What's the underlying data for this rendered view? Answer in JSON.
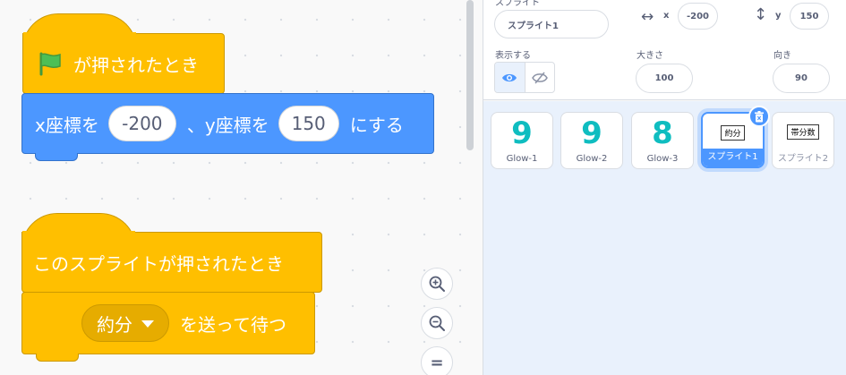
{
  "workspace": {
    "script1": {
      "hat_label": "が押されたとき",
      "flag_icon": "green-flag-icon",
      "goto_x_label": "x座標を",
      "x_value": "-200",
      "goto_y_label": "、y座標を",
      "y_value": "150",
      "goto_suffix": "にする"
    },
    "script2": {
      "hat_label": "このスプライトが押されたとき",
      "broadcast_value": "約分",
      "broadcast_suffix": "を送って待つ"
    },
    "zoom": {
      "zoom_in_icon": "zoom-in-icon",
      "zoom_out_icon": "zoom-out-icon",
      "reset_icon": "zoom-reset-icon",
      "reset_symbol": "="
    }
  },
  "sprite_info": {
    "sprite_label": "スプライト",
    "sprite_name": "スプライト1",
    "x_label": "x",
    "x_value": "-200",
    "y_label": "y",
    "y_value": "150",
    "show_label": "表示する",
    "size_label": "大きさ",
    "size_value": "100",
    "direction_label": "向き",
    "direction_value": "90"
  },
  "sprites": [
    {
      "name": "Glow-1",
      "glyph": "9"
    },
    {
      "name": "Glow-2",
      "glyph": "9"
    },
    {
      "name": "Glow-3",
      "glyph": "8"
    },
    {
      "name": "スプライト1",
      "costume_text": "約分",
      "selected": true
    },
    {
      "name": "スプライト2",
      "costume_text": "帯分数"
    }
  ],
  "colors": {
    "events": "#ffbf00",
    "motion": "#4c97ff",
    "accent": "#4c97ff",
    "glow": "#0fbdc0"
  }
}
